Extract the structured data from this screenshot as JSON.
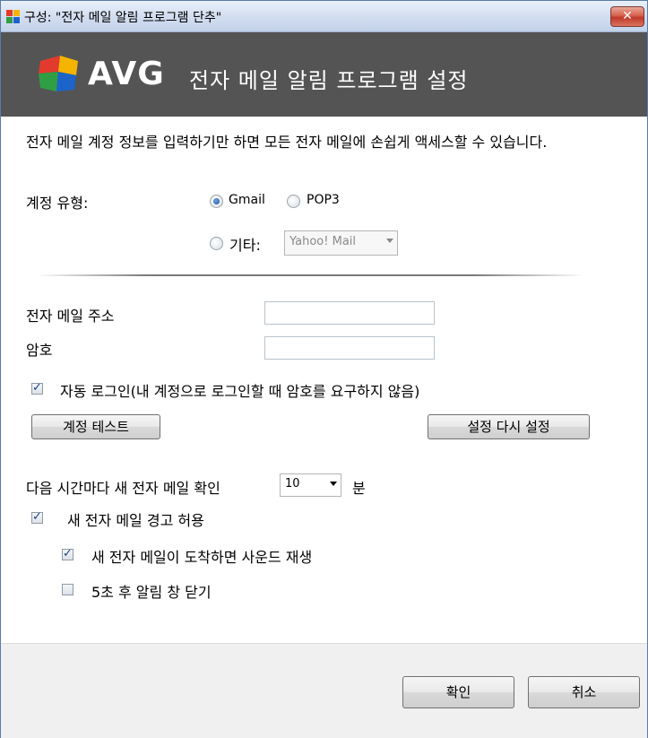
{
  "window": {
    "title": "구성: \"전자 메일 알림 프로그램 단추\""
  },
  "header": {
    "logo_text": "AVG",
    "title": "전자 메일 알림 프로그램 설정"
  },
  "intro": "전자 메일 계정 정보를 입력하기만 하면 모든 전자 메일에 손쉽게 액세스할 수 있습니다.",
  "account_type": {
    "label": "계정 유형:",
    "options": [
      "Gmail",
      "POP3",
      "기타:"
    ],
    "selected": "Gmail",
    "other_provider": "Yahoo! Mail"
  },
  "fields": {
    "email_label": "전자 메일 주소",
    "email_value": "",
    "password_label": "암호",
    "password_value": ""
  },
  "auto_login": {
    "label": "자동 로그인(내 계정으로 로그인할 때 암호를 요구하지 않음)",
    "checked": true
  },
  "buttons": {
    "test_account": "계정 테스트",
    "reset_settings": "설정 다시 설정",
    "ok": "확인",
    "cancel": "취소"
  },
  "check_interval": {
    "label": "다음 시간마다 새 전자 메일 확인",
    "value": "10",
    "unit": "분"
  },
  "alerts": {
    "enable_alert": {
      "label": "새 전자 메일 경고 허용",
      "checked": true
    },
    "play_sound": {
      "label": "새 전자 메일이 도착하면 사운드 재생",
      "checked": true
    },
    "close_after": {
      "label": "5초 후 알림 창 닫기",
      "checked": false
    }
  },
  "colors": {
    "header_bg": "#545454",
    "close_button": "#c0392b"
  }
}
